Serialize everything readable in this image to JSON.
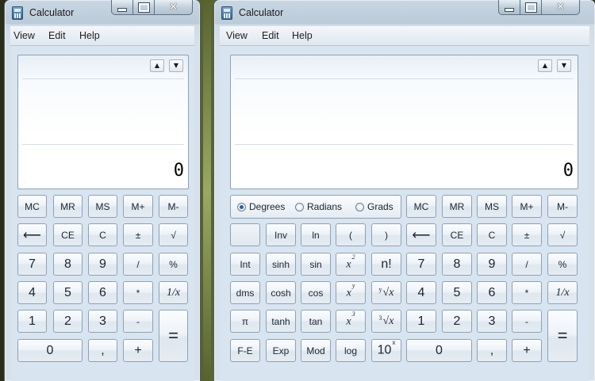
{
  "windows": [
    {
      "id": "standard",
      "title": "Calculator",
      "menu": [
        "View",
        "Edit",
        "Help"
      ],
      "display": {
        "value": "0",
        "up_arrow": "▲",
        "down_arrow": "▼"
      },
      "window_buttons": {
        "close": "✕"
      },
      "keys": [
        [
          "MC",
          "MR",
          "MS",
          "M+",
          "M-"
        ],
        [
          "⟵",
          "CE",
          "C",
          "±",
          "√"
        ],
        [
          "7",
          "8",
          "9",
          "/",
          "%"
        ],
        [
          "4",
          "5",
          "6",
          "*",
          "1/x"
        ],
        [
          "1",
          "2",
          "3",
          "-",
          "="
        ],
        [
          "0",
          ",",
          "+"
        ]
      ]
    },
    {
      "id": "scientific",
      "title": "Calculator",
      "menu": [
        "View",
        "Edit",
        "Help"
      ],
      "display": {
        "value": "0",
        "up_arrow": "▲",
        "down_arrow": "▼"
      },
      "window_buttons": {
        "close": "✕"
      },
      "angle_modes": {
        "options": [
          "Degrees",
          "Radians",
          "Grads"
        ],
        "selected": "Degrees"
      },
      "sci_keys": [
        [
          "",
          "Inv",
          "ln",
          "(",
          ")"
        ],
        [
          "Int",
          "sinh",
          "sin",
          "x2",
          "n!"
        ],
        [
          "dms",
          "cosh",
          "cos",
          "xy",
          "y√x"
        ],
        [
          "π",
          "tanh",
          "tan",
          "x3",
          "3√x"
        ],
        [
          "F-E",
          "Exp",
          "Mod",
          "log",
          "10x"
        ]
      ],
      "keys": [
        [
          "MC",
          "MR",
          "MS",
          "M+",
          "M-"
        ],
        [
          "⟵",
          "CE",
          "C",
          "±",
          "√"
        ],
        [
          "7",
          "8",
          "9",
          "/",
          "%"
        ],
        [
          "4",
          "5",
          "6",
          "*",
          "1/x"
        ],
        [
          "1",
          "2",
          "3",
          "-",
          "="
        ],
        [
          "0",
          ",",
          "+"
        ]
      ]
    }
  ]
}
